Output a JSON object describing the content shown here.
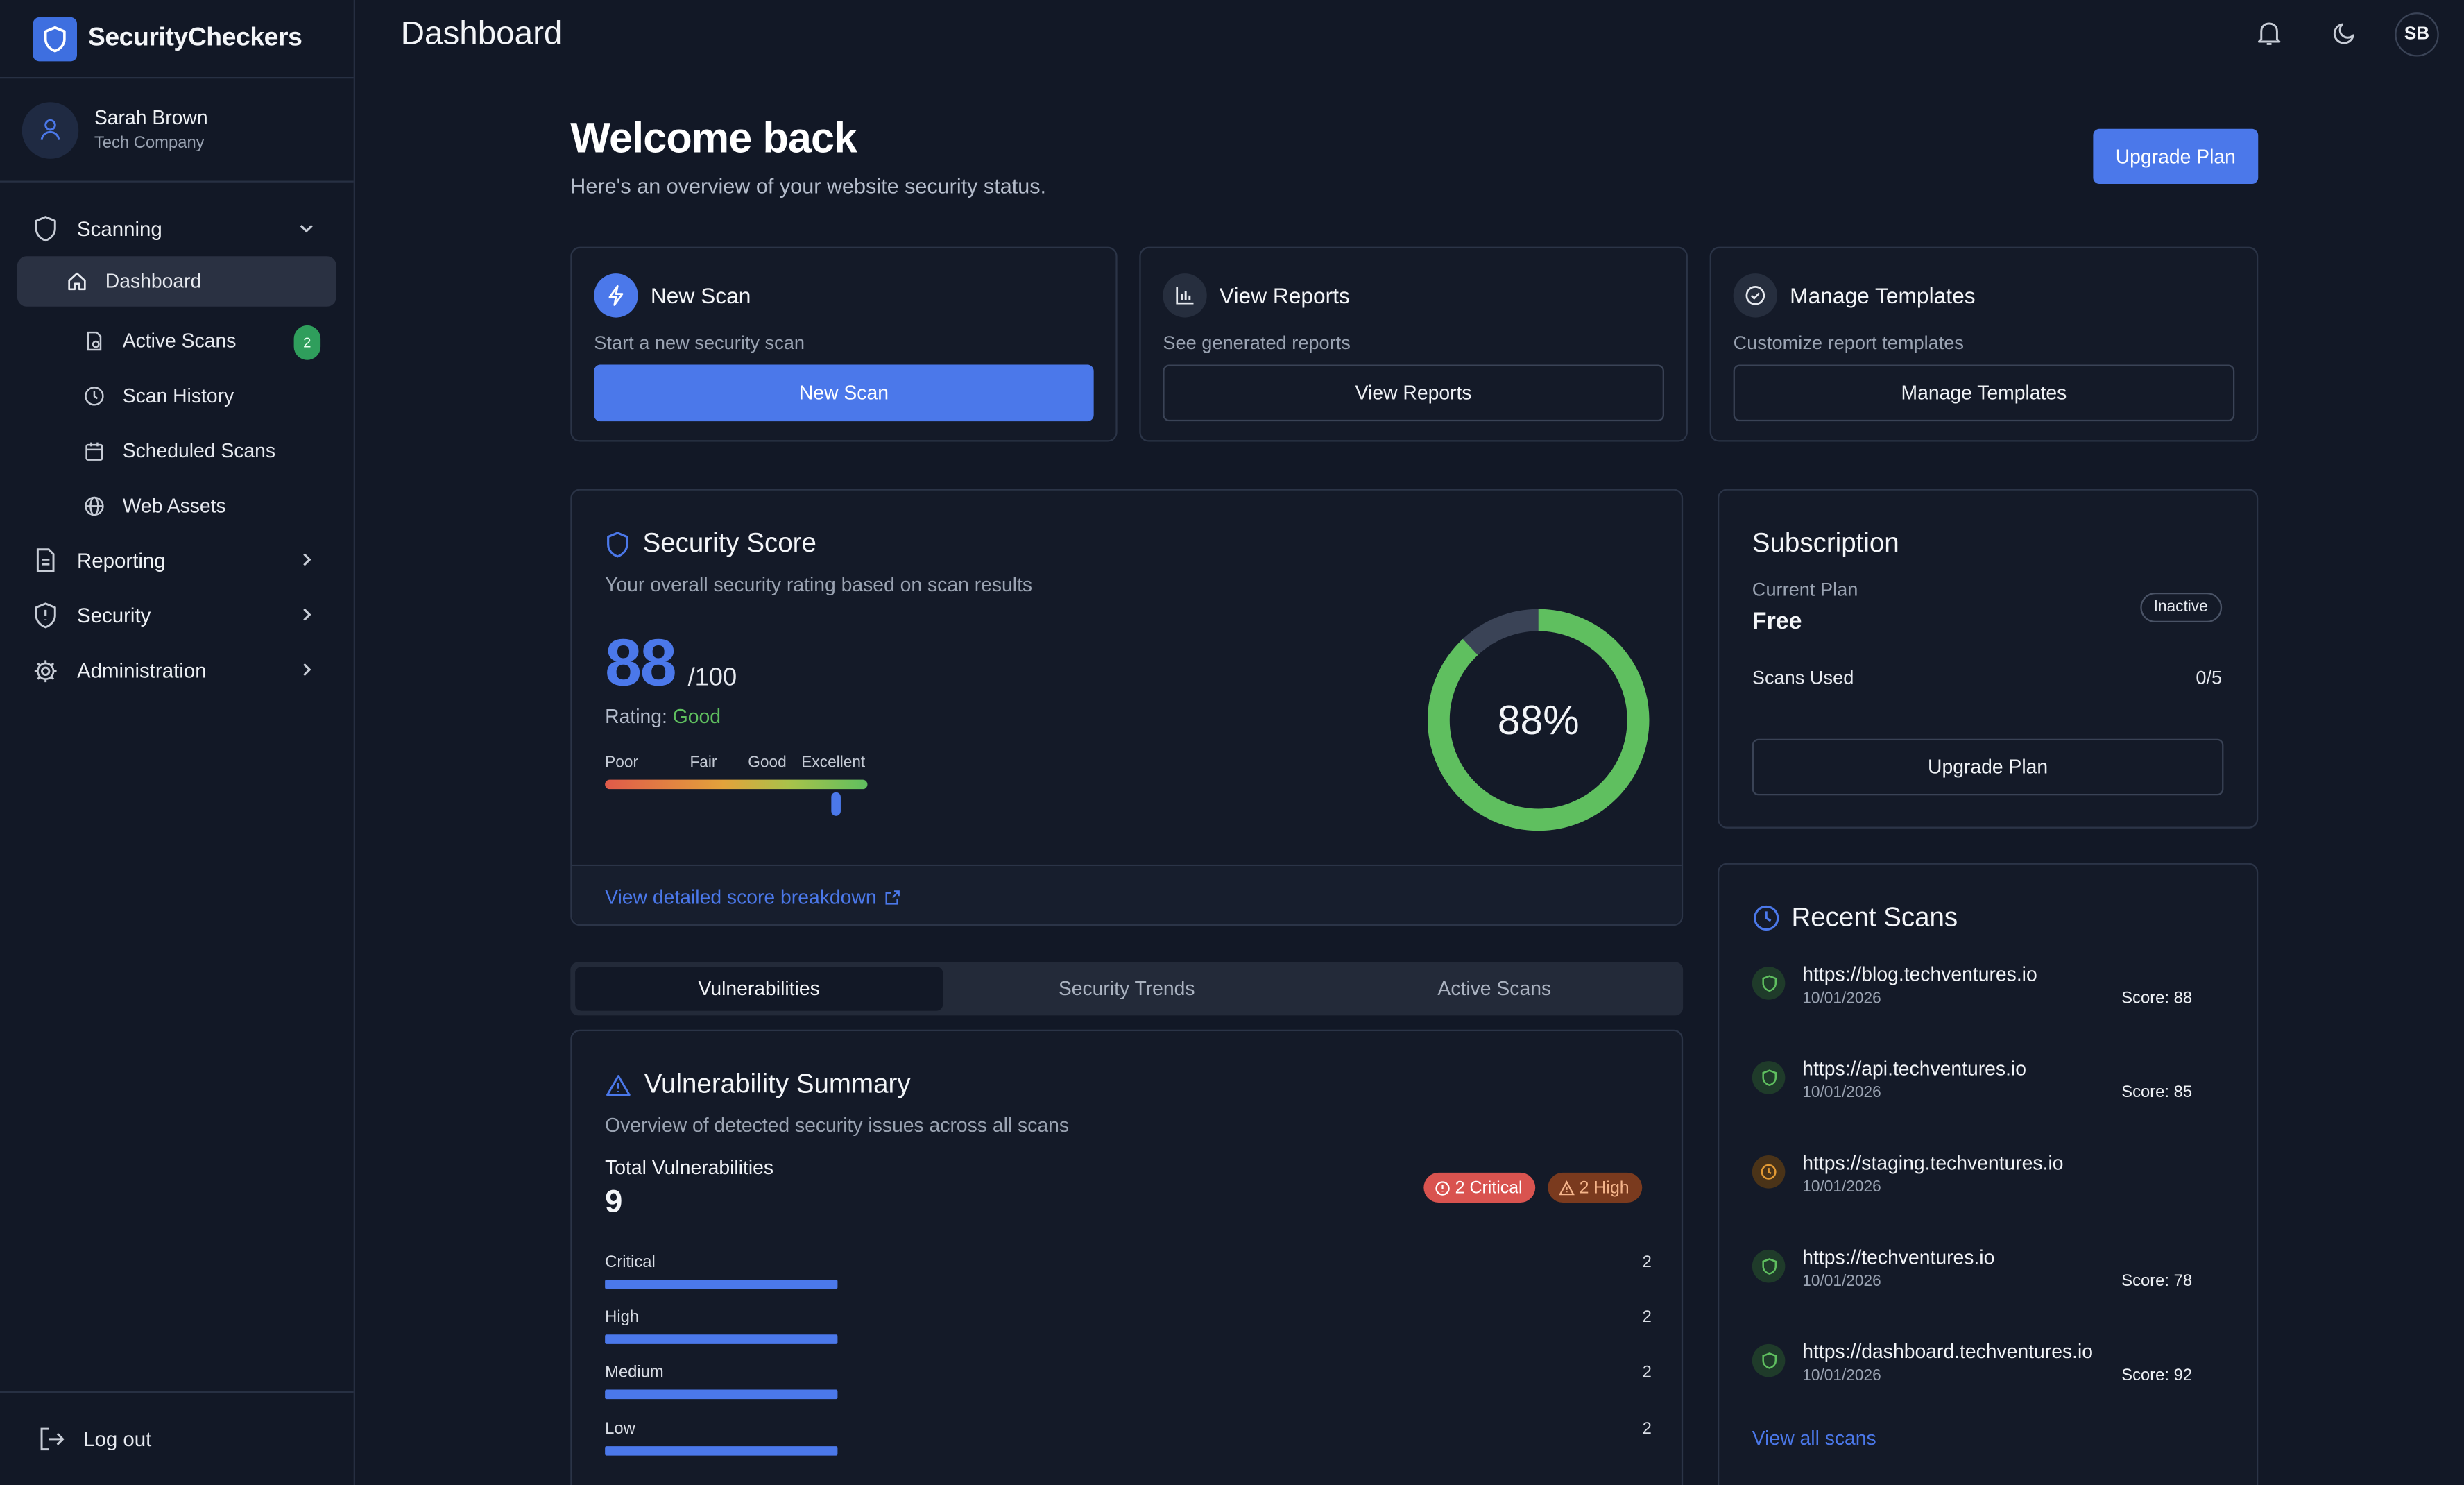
{
  "brand": {
    "name": "SecurityCheckers",
    "color": "#3e6fe0"
  },
  "user": {
    "name": "Sarah Brown",
    "org": "Tech Company",
    "initials": "SB"
  },
  "sidebar": {
    "groups": [
      {
        "label": "Scanning",
        "icon": "shield-icon",
        "expanded": true
      },
      {
        "label": "Reporting",
        "icon": "document-icon"
      },
      {
        "label": "Security",
        "icon": "shield-alert-icon"
      },
      {
        "label": "Administration",
        "icon": "gear-icon"
      }
    ],
    "scanning_items": [
      {
        "label": "Dashboard",
        "icon": "home-icon",
        "active": true
      },
      {
        "label": "Active Scans",
        "icon": "file-scan-icon",
        "badge": "2"
      },
      {
        "label": "Scan History",
        "icon": "clock-icon"
      },
      {
        "label": "Scheduled Scans",
        "icon": "calendar-icon"
      },
      {
        "label": "Web Assets",
        "icon": "globe-icon"
      }
    ],
    "logout": "Log out"
  },
  "header": {
    "title": "Dashboard"
  },
  "welcome": {
    "title": "Welcome back",
    "subtitle": "Here's an overview of your website security status.",
    "upgrade_button": "Upgrade Plan"
  },
  "actions": [
    {
      "title": "New Scan",
      "desc": "Start a new security scan",
      "button": "New Scan",
      "icon": "lightning-icon"
    },
    {
      "title": "View Reports",
      "desc": "See generated reports",
      "button": "View Reports",
      "icon": "bar-chart-icon"
    },
    {
      "title": "Manage Templates",
      "desc": "Customize report templates",
      "button": "Manage Templates",
      "icon": "check-circle-icon"
    }
  ],
  "security_score": {
    "title": "Security Score",
    "subtitle": "Your overall security rating based on scan results",
    "score": "88",
    "max": "/100",
    "rating_label": "Rating:",
    "rating": "Good",
    "scale": [
      "Poor",
      "Fair",
      "Good",
      "Excellent"
    ],
    "percent_text": "88%",
    "percent": 0.88,
    "breakdown_link": "View detailed score breakdown"
  },
  "subscription": {
    "title": "Subscription",
    "plan_label": "Current Plan",
    "plan": "Free",
    "status": "Inactive",
    "scans_label": "Scans Used",
    "scans_value": "0/5",
    "upgrade_button": "Upgrade Plan"
  },
  "tabs": [
    {
      "label": "Vulnerabilities",
      "active": true
    },
    {
      "label": "Security Trends"
    },
    {
      "label": "Active Scans"
    }
  ],
  "vulnerabilities": {
    "title": "Vulnerability Summary",
    "subtitle": "Overview of detected security issues across all scans",
    "total_label": "Total Vulnerabilities",
    "total": "9",
    "critical_pill": "2 Critical",
    "high_pill": "2 High",
    "rows": [
      {
        "label": "Critical",
        "count": "2"
      },
      {
        "label": "High",
        "count": "2"
      },
      {
        "label": "Medium",
        "count": "2"
      },
      {
        "label": "Low",
        "count": "2"
      }
    ]
  },
  "recent_scans": {
    "title": "Recent Scans",
    "items": [
      {
        "url": "https://blog.techventures.io",
        "date": "10/01/2026",
        "score": "Score: 88",
        "status": "complete"
      },
      {
        "url": "https://api.techventures.io",
        "date": "10/01/2026",
        "score": "Score: 85",
        "status": "complete"
      },
      {
        "url": "https://staging.techventures.io",
        "date": "10/01/2026",
        "score": "",
        "status": "pending"
      },
      {
        "url": "https://techventures.io",
        "date": "10/01/2026",
        "score": "Score: 78",
        "status": "complete"
      },
      {
        "url": "https://dashboard.techventures.io",
        "date": "10/01/2026",
        "score": "Score: 92",
        "status": "complete"
      }
    ],
    "view_all": "View all scans"
  },
  "colors": {
    "accent": "#4b78ea",
    "good": "#5fbf5f",
    "critical": "#d9534f",
    "high": "#b0572a",
    "pending": "#d38b2a"
  }
}
